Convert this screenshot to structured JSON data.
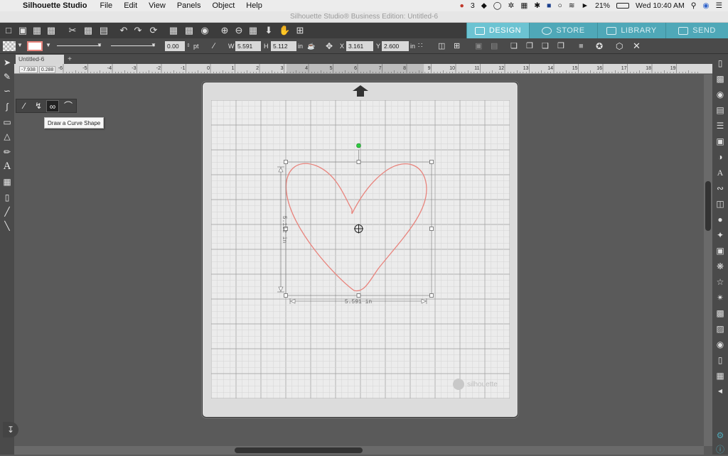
{
  "menubar": {
    "app_name": "Silhouette Studio",
    "items": [
      "File",
      "Edit",
      "View",
      "Panels",
      "Object",
      "Help"
    ],
    "status": {
      "notify_count": "3",
      "battery": "21%",
      "clock": "Wed 10:40 AM"
    }
  },
  "window": {
    "title": "Silhouette Studio® Business Edition: Untitled-6"
  },
  "toptabs": [
    {
      "label": "DESIGN",
      "icon": "grid-icon"
    },
    {
      "label": "STORE",
      "icon": "store-icon"
    },
    {
      "label": "LIBRARY",
      "icon": "library-icon"
    },
    {
      "label": "SEND",
      "icon": "send-icon"
    }
  ],
  "props": {
    "line_width": "0.00",
    "line_unit": "pt",
    "w_label": "W",
    "w_value": "5.591",
    "h_label": "H",
    "h_value": "5.112",
    "size_unit": "in",
    "x_label": "X",
    "x_value": "3.161",
    "y_label": "Y",
    "y_value": "2.600",
    "pos_unit": "in"
  },
  "document": {
    "tab_label": "Untitled-6",
    "add_tab": "+"
  },
  "ruler": {
    "cursor_x": "-7.938",
    "cursor_y": "0.288",
    "ticks": [
      "-6",
      "-5",
      "-4",
      "-3",
      "-2",
      "-1",
      "0",
      "1",
      "2",
      "3",
      "4",
      "5",
      "6",
      "7",
      "8",
      "9",
      "10",
      "11",
      "12",
      "13",
      "14",
      "15",
      "16",
      "17",
      "18",
      "19"
    ]
  },
  "tooltip": "Draw a Curve Shape",
  "selection": {
    "width_label": "5.591 in",
    "height_label": "5.112 in"
  },
  "mat": {
    "logo_text": "silhouette"
  },
  "colors": {
    "accent": "#6cc3d2",
    "tab_bg": "#4fa8b8",
    "heart_stroke": "#e8837c",
    "rotate_handle": "#2ecc40"
  }
}
